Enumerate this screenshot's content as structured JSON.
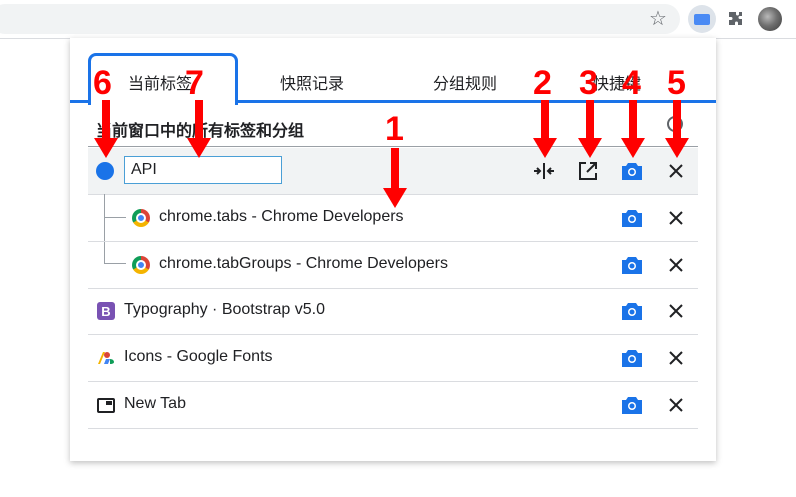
{
  "toolbar": {
    "icons": [
      "star-icon",
      "tab-manager-extension-icon",
      "puzzle-icon",
      "avatar"
    ]
  },
  "popup": {
    "tabs": [
      {
        "label": "当前标签"
      },
      {
        "label": "快照记录"
      },
      {
        "label": "分组规则"
      },
      {
        "label": "快捷键"
      }
    ],
    "heading": "当前窗口中的所有标签和分组"
  },
  "group": {
    "name_value": "API",
    "color": "#1a73e8",
    "tabs": [
      {
        "title": "chrome.tabs - Chrome Developers",
        "favicon": "chrome-icon"
      },
      {
        "title": "chrome.tabGroups - Chrome Developers",
        "favicon": "chrome-icon"
      }
    ]
  },
  "tabs": [
    {
      "title": "Typography · Bootstrap v5.0",
      "favicon": "bootstrap-icon",
      "favicon_text": "B"
    },
    {
      "title": "Icons - Google Fonts",
      "favicon": "google-fonts-icon"
    },
    {
      "title": "New Tab",
      "favicon": "new-tab-icon"
    }
  ],
  "annotations": [
    "1",
    "2",
    "3",
    "4",
    "5",
    "6",
    "7"
  ],
  "colors": {
    "accent": "#1a73e8",
    "annotation": "#ff0000"
  }
}
